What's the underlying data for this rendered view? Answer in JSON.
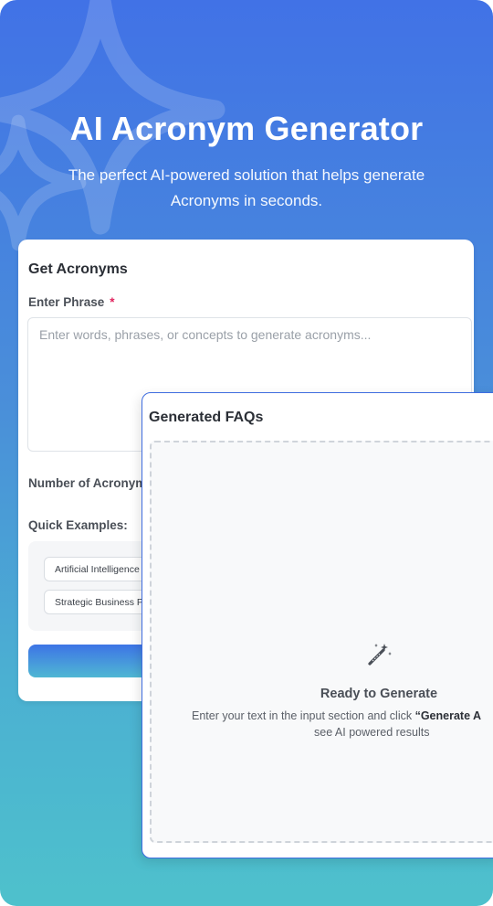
{
  "hero": {
    "title": "AI Acronym Generator",
    "subtitle": "The perfect AI-powered solution that helps generate Acronyms in seconds."
  },
  "form": {
    "heading": "Get Acronyms",
    "phrase_label": "Enter Phrase",
    "required_mark": "*",
    "phrase_placeholder": "Enter words, phrases, or concepts to generate acronyms...",
    "number_label": "Number of Acronyms",
    "quick_label": "Quick Examples:",
    "examples": [
      "Artificial Intelligence",
      "Strategic Business P"
    ],
    "generate_label": ""
  },
  "results": {
    "heading": "Generated FAQs",
    "empty_title": "Ready to Generate",
    "empty_desc_prefix": "Enter your text in the input section and click ",
    "empty_desc_bold": "“Generate A",
    "empty_desc_line2": "see AI powered results",
    "empty_icon": "magic-wand-icon"
  },
  "colors": {
    "gradient_top": "#4172e6",
    "gradient_bottom": "#4ec1cc",
    "required": "#e0245e",
    "accent_border": "#3f6de0"
  }
}
